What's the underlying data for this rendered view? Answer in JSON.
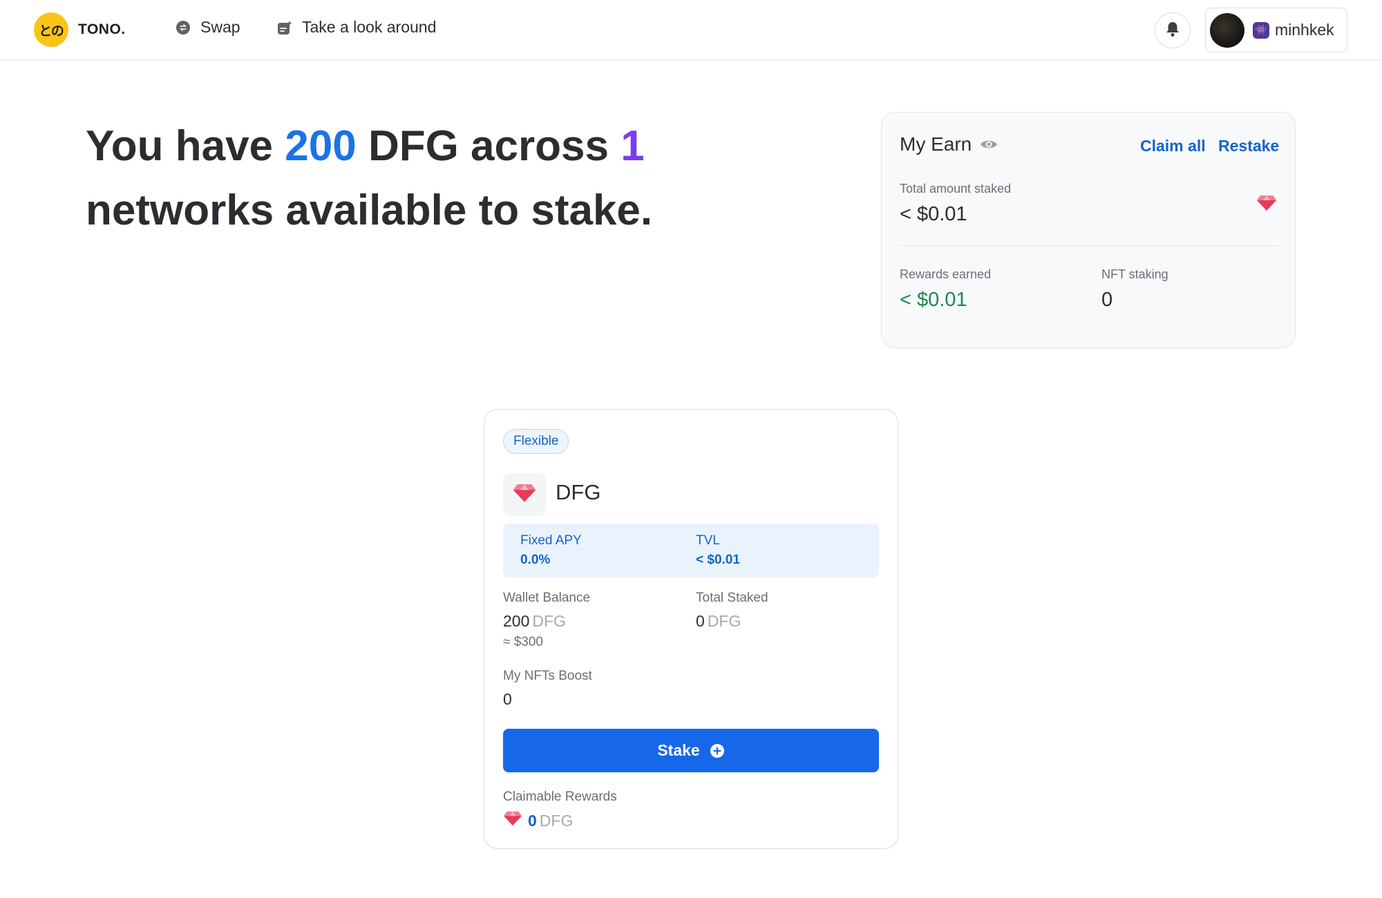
{
  "header": {
    "logo_badge": "との",
    "logo_text": "TONO.",
    "nav": [
      {
        "label": "Swap",
        "icon": "swap-icon"
      },
      {
        "label": "Take a look around",
        "icon": "explore-icon"
      }
    ],
    "bell_icon": "bell-icon",
    "user": {
      "emoji": "👾",
      "name": "minhkek"
    }
  },
  "hero": {
    "part1": "You have ",
    "amount": "200",
    "part2": " DFG across ",
    "networks": "1",
    "part3": " networks available to stake."
  },
  "earn": {
    "title": "My Earn",
    "claim_all": "Claim all",
    "restake": "Restake",
    "total_staked_label": "Total amount staked",
    "total_staked_value": "< $0.01",
    "rewards_label": "Rewards earned",
    "rewards_value": "< $0.01",
    "nft_label": "NFT staking",
    "nft_value": "0"
  },
  "stake_card": {
    "badge": "Flexible",
    "token": "DFG",
    "apy_label": "Fixed APY",
    "apy_value": "0.0%",
    "tvl_label": "TVL",
    "tvl_value": "< $0.01",
    "wallet_label": "Wallet Balance",
    "wallet_value": "200",
    "wallet_unit": "DFG",
    "wallet_usd": "≈ $300",
    "staked_label": "Total Staked",
    "staked_value": "0",
    "staked_unit": "DFG",
    "nft_boost_label": "My NFTs Boost",
    "nft_boost_value": "0",
    "stake_button": "Stake",
    "claimable_label": "Claimable Rewards",
    "claimable_value": "0",
    "claimable_unit": "DFG"
  },
  "colors": {
    "accent_blue": "#1a73e8",
    "accent_purple": "#7a3cf0",
    "button_blue": "#1668e8",
    "reward_green": "#1b8a4b",
    "logo_yellow": "#fcc419"
  }
}
